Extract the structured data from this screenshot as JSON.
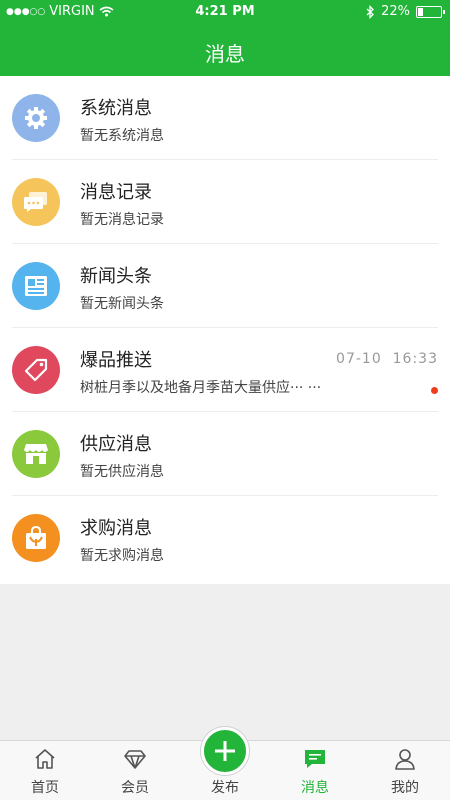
{
  "status_bar": {
    "carrier": "VIRGIN",
    "time": "4:21 PM",
    "battery": "22%",
    "battery_level": 0.22
  },
  "header": {
    "title": "消息"
  },
  "messages": [
    {
      "title": "系统消息",
      "subtitle": "暂无系统消息",
      "icon": "gear-icon",
      "color": "#8fb4ea"
    },
    {
      "title": "消息记录",
      "subtitle": "暂无消息记录",
      "icon": "chat-record-icon",
      "color": "#f5c55c"
    },
    {
      "title": "新闻头条",
      "subtitle": "暂无新闻头条",
      "icon": "newspaper-icon",
      "color": "#55b3ee"
    },
    {
      "title": "爆品推送",
      "subtitle": "树桩月季以及地备月季苗大量供应··· ···",
      "icon": "tag-icon",
      "color": "#e0485e",
      "date": "07-10",
      "time": "16:33",
      "unread": true
    },
    {
      "title": "供应消息",
      "subtitle": "暂无供应消息",
      "icon": "storefront-icon",
      "color": "#8ac83c"
    },
    {
      "title": "求购消息",
      "subtitle": "暂无求购消息",
      "icon": "shopping-bag-icon",
      "color": "#f39020"
    }
  ],
  "tabbar": {
    "tabs": [
      {
        "label": "首页",
        "icon": "home-icon"
      },
      {
        "label": "会员",
        "icon": "diamond-icon"
      },
      {
        "label": "发布",
        "icon": "plus-icon"
      },
      {
        "label": "消息",
        "icon": "message-icon",
        "active": true
      },
      {
        "label": "我的",
        "icon": "user-icon"
      }
    ]
  },
  "colors": {
    "brand": "#23b43a",
    "unread": "#f03c1e"
  }
}
